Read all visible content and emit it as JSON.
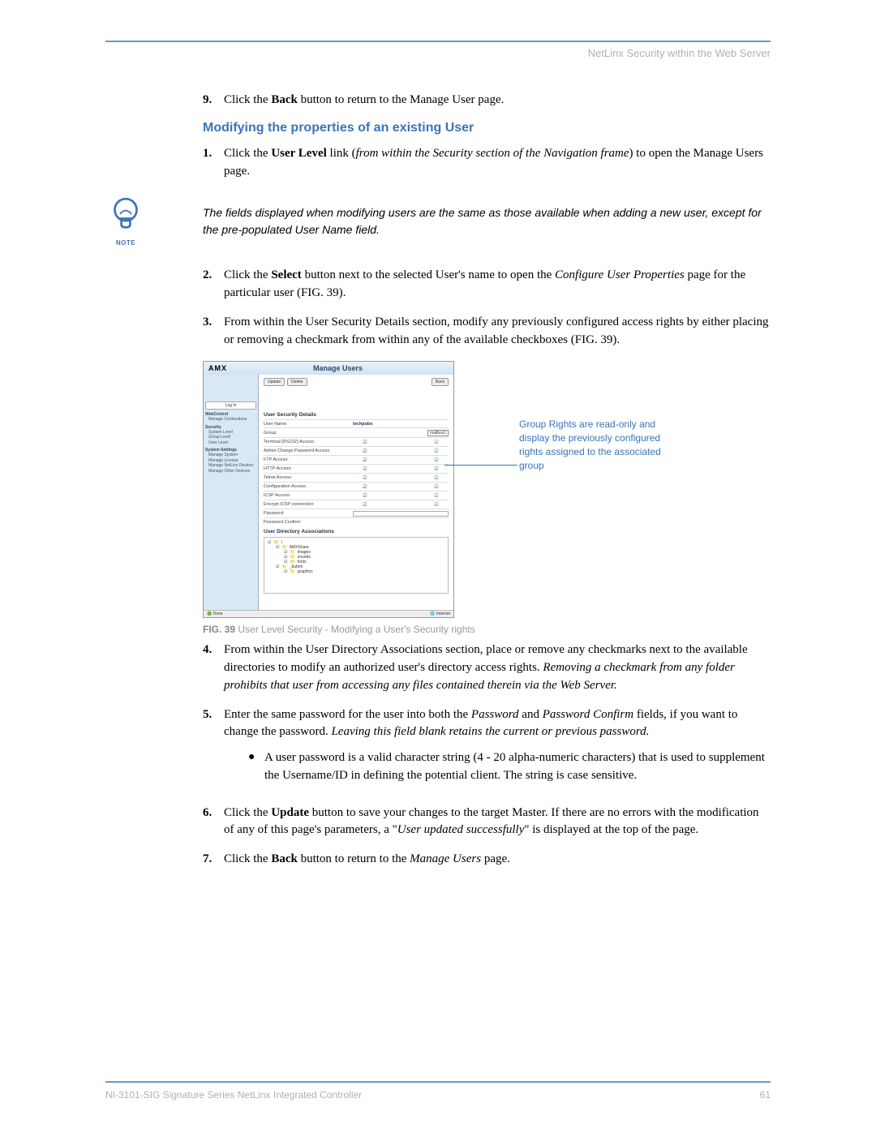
{
  "header": {
    "running_title": "NetLinx Security within the Web Server"
  },
  "intro_item": {
    "num": "9.",
    "pre": "Click the ",
    "b1": "Back",
    "post": " button to return to the Manage User page."
  },
  "section_heading": "Modifying the properties of an existing User",
  "step1": {
    "num": "1.",
    "t1": "Click the ",
    "b1": "User Level",
    "t2": " link (",
    "i1": "from within the Security section of the Navigation frame",
    "t3": ") to open the Manage Users page."
  },
  "note": {
    "label": "NOTE",
    "text": "The fields displayed when modifying users are the same as those available when adding a new user, except for the pre-populated User Name field."
  },
  "step2": {
    "num": "2.",
    "t1": "Click the ",
    "b1": "Select",
    "t2": " button next to the selected User's name to open the ",
    "i1": "Configure User Properties",
    "t3": " page for the particular user (FIG. 39)."
  },
  "step3": {
    "num": "3.",
    "text": "From within the User Security Details section, modify any previously configured access rights by either placing or removing a checkmark from within any of the available checkboxes (FIG. 39)."
  },
  "figure": {
    "logo": "AMX",
    "title": "Manage Users",
    "toolbar": {
      "update": "Update",
      "delete": "Delete",
      "back": "Back"
    },
    "side": {
      "login": "Log In",
      "g1": "WebControl",
      "g1a": "Manage Connections",
      "g2": "Security",
      "g2a": "System Level",
      "g2b": "Group Level",
      "g2c": "User Level",
      "g3": "System Settings",
      "g3a": "Manage System",
      "g3b": "Manage License",
      "g3c": "Manage NetLinx Devices",
      "g3d": "Manage Other Devices"
    },
    "details_head": "User Security Details",
    "rows": {
      "username_l": "User Name:",
      "username_v": "techpubs",
      "group_l": "Group:",
      "group_v": "mailbox1",
      "r1": "Terminal (RS232) Access:",
      "r2": "Admin Change Password Access:",
      "r3": "FTP Access:",
      "r4": "HTTP Access:",
      "r5": "Telnet Access:",
      "r6": "Configuration Access:",
      "r7": "ICSP Access:",
      "r8": "Encrypt ICSP connection:",
      "pw": "Password:",
      "pwc": "Password Confirm:"
    },
    "dir_head": "User Directory Associations",
    "dirs": {
      "d0": "/",
      "d1": "AMXShare",
      "d2": "images",
      "d3": "sounds",
      "d4": "fonts",
      "d5": "_button",
      "d6": "graphics"
    },
    "status_left": "Done",
    "status_right": "Internet",
    "callout": "Group Rights are read-only and display the previously configured rights assigned to the associated group",
    "caption_b": "FIG. 39",
    "caption_t": "  User Level Security - Modifying a User's Security rights"
  },
  "step4": {
    "num": "4.",
    "t1": "From within the User Directory Associations section, place or remove any checkmarks next to the available directories to modify an authorized user's directory access rights. ",
    "i1": "Removing a checkmark from any folder prohibits that user from accessing any files contained therein via the Web Server."
  },
  "step5": {
    "num": "5.",
    "t1": "Enter the same password for the user into both the ",
    "i1": "Password",
    "t2": " and ",
    "i2": "Password Confirm",
    "t3": " fields, if you want to change the password. ",
    "i3": "Leaving this field blank retains the current or previous password."
  },
  "bullet5a": {
    "text": "A user password is a valid character string (4 - 20 alpha-numeric characters) that is used to supplement the Username/ID in defining the potential client. The string is case sensitive."
  },
  "step6": {
    "num": "6.",
    "t1": "Click the ",
    "b1": "Update",
    "t2": " button to save your changes to the target Master. If there are no errors with the modification of any of this page's parameters, a \"",
    "i1": "User updated successfully",
    "t3": "\" is displayed at the top of the page."
  },
  "step7": {
    "num": "7.",
    "t1": "Click the ",
    "b1": "Back",
    "t2": " button to return to the ",
    "i1": "Manage Users",
    "t3": " page."
  },
  "footer": {
    "left": "NI-3101-SIG Signature Series NetLinx Integrated Controller",
    "right": "61"
  }
}
